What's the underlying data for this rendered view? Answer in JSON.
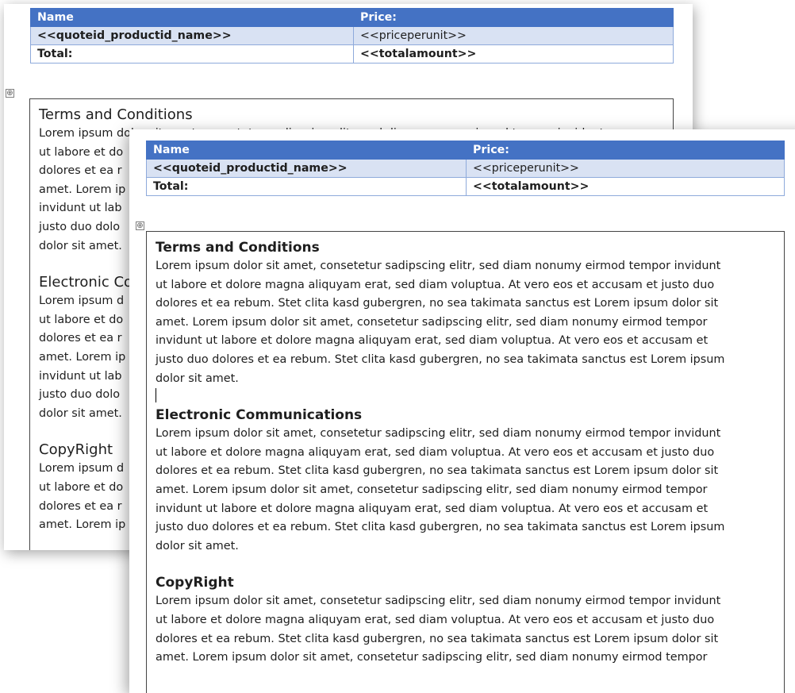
{
  "quote_table": {
    "header": {
      "name": "Name",
      "price": "Price:"
    },
    "product_row": {
      "name": "<<quoteid_productid_name>>",
      "price": "<<priceperunit>>"
    },
    "total_row": {
      "label": "Total:",
      "amount": "<<totalamount>>"
    }
  },
  "table_move_handle_glyph": "⊕",
  "back_page": {
    "sections": [
      {
        "title": "Terms and Conditions",
        "text": "Lorem ipsum dolor sit amet, consetetur sadipscing elitr, sed diam nonumy eirmod tempor invidunt\nut labore et do\ndolores et ea r\namet. Lorem ip\ninvidunt ut lab\njusto duo dolo\ndolor sit amet."
      },
      {
        "title": "Electronic Co",
        "text": "Lorem ipsum d\nut labore et do\ndolores et ea r\namet. Lorem ip\ninvidunt ut lab\njusto duo dolo\ndolor sit amet."
      },
      {
        "title": "CopyRight",
        "text": "Lorem ipsum d\nut labore et do\ndolores et ea r\namet. Lorem ip"
      }
    ]
  },
  "front_page": {
    "sections": [
      {
        "title": "Terms and Conditions",
        "text": "Lorem ipsum dolor sit amet, consetetur sadipscing elitr, sed diam nonumy eirmod tempor invidunt\nut labore et dolore magna aliquyam erat, sed diam voluptua. At vero eos et accusam et justo duo\ndolores et ea rebum. Stet clita kasd gubergren, no sea takimata sanctus est Lorem ipsum dolor sit\namet. Lorem ipsum dolor sit amet, consetetur sadipscing elitr, sed diam nonumy eirmod tempor\ninvidunt ut labore et dolore magna aliquyam erat, sed diam voluptua. At vero eos et accusam et\njusto duo dolores et ea rebum. Stet clita kasd gubergren, no sea takimata sanctus est Lorem ipsum\ndolor sit amet."
      },
      {
        "title": "Electronic Communications",
        "text": "Lorem ipsum dolor sit amet, consetetur sadipscing elitr, sed diam nonumy eirmod tempor invidunt\nut labore et dolore magna aliquyam erat, sed diam voluptua. At vero eos et accusam et justo duo\ndolores et ea rebum. Stet clita kasd gubergren, no sea takimata sanctus est Lorem ipsum dolor sit\namet. Lorem ipsum dolor sit amet, consetetur sadipscing elitr, sed diam nonumy eirmod tempor\ninvidunt ut labore et dolore magna aliquyam erat, sed diam voluptua. At vero eos et accusam et\njusto duo dolores et ea rebum. Stet clita kasd gubergren, no sea takimata sanctus est Lorem ipsum\ndolor sit amet."
      },
      {
        "title": "CopyRight",
        "text": "Lorem ipsum dolor sit amet, consetetur sadipscing elitr, sed diam nonumy eirmod tempor invidunt\nut labore et dolore magna aliquyam erat, sed diam voluptua. At vero eos et accusam et justo duo\ndolores et ea rebum. Stet clita kasd gubergren, no sea takimata sanctus est Lorem ipsum dolor sit\namet. Lorem ipsum dolor sit amet, consetetur sadipscing elitr, sed diam nonumy eirmod tempor"
      }
    ]
  },
  "colors": {
    "table_header": "#4472c4",
    "table_row_shade": "#d9e2f3",
    "table_border": "#8eaadb"
  }
}
